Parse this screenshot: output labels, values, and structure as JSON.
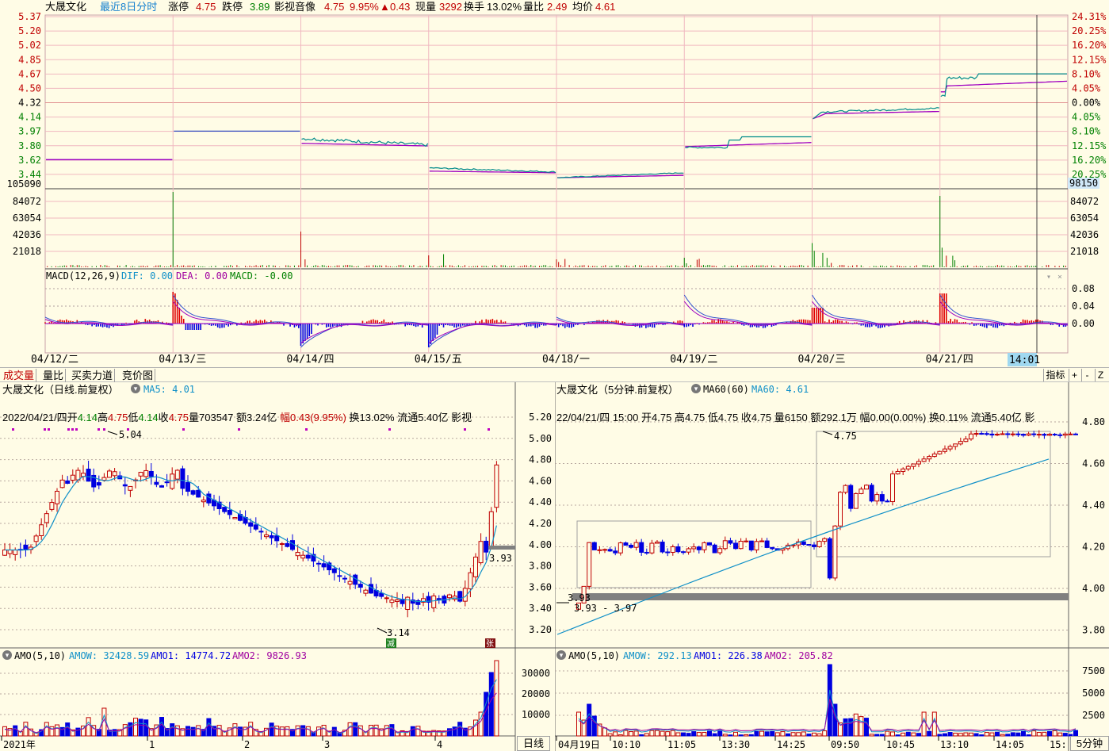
{
  "header": {
    "stock_name": "大晟文化",
    "period": "最近8日分时",
    "limit_up_label": "涨停",
    "limit_up": "4.75",
    "limit_down_label": "跌停",
    "limit_down": "3.89",
    "sector": "影视音像",
    "price": "4.75",
    "change_pct": "9.95%",
    "change": "0.43",
    "volume_label": "现量",
    "volume": "3292",
    "turnover_label": "换手",
    "turnover": "13.02%",
    "vol_ratio_label": "量比",
    "vol_ratio": "2.49",
    "avg_label": "均价",
    "avg": "4.61"
  },
  "intraday": {
    "left_axis": [
      "5.37",
      "5.20",
      "5.02",
      "4.85",
      "4.67",
      "4.50",
      "4.32",
      "4.14",
      "3.97",
      "3.80",
      "3.62",
      "3.44"
    ],
    "right_axis": [
      "24.31%",
      "20.25%",
      "16.20%",
      "12.15%",
      "8.10%",
      "4.05%",
      "0.00%",
      "4.05%",
      "8.10%",
      "12.15%",
      "16.20%",
      "20.25%"
    ],
    "vol_max": "105090",
    "vol_cursor": "98150",
    "vol_axis": [
      "84072",
      "63054",
      "42036",
      "21018"
    ],
    "macd_label": "MACD(12,26,9)",
    "dif_label": "DIF: 0.00",
    "dea_label": "DEA: 0.00",
    "macd_val_label": "MACD: -0.00",
    "macd_axis": [
      "0.08",
      "0.04",
      "0.00"
    ],
    "dates": [
      "04/12/二",
      "04/13/三",
      "04/14/四",
      "04/15/五",
      "04/18/一",
      "04/19/二",
      "04/20/三",
      "04/21/四"
    ],
    "cursor_time": "14:01"
  },
  "tabs": [
    "成交量",
    "量比",
    "买卖力道",
    "竞价图"
  ],
  "tab_buttons": [
    "指标",
    "+",
    "-",
    "Z"
  ],
  "daily": {
    "title": "大晟文化（日线.前复权）",
    "ma_label": "MA5: 4.01",
    "info": "2022/04/21/四",
    "open_label": "开",
    "open": "4.14",
    "high_label": "高",
    "high": "4.75",
    "low_label": "低",
    "low": "4.14",
    "close_label": "收",
    "close": "4.75",
    "vol_label": "量",
    "vol": "703547",
    "amt_label": "额",
    "amt": "3.24亿",
    "amp_label": "幅",
    "amp": "0.43(9.95%)",
    "turn_label": "换",
    "turn": "13.02%",
    "float_label": "流通",
    "float": "5.40亿",
    "more": "影视",
    "high_mark": "5.04",
    "low_mark": "3.14",
    "last_mark": "3.93",
    "axis": [
      "5.20",
      "5.00",
      "4.80",
      "4.60",
      "4.40",
      "4.20",
      "4.00",
      "3.80",
      "3.60",
      "3.40",
      "3.20"
    ],
    "x_labels": [
      "2021年",
      "1",
      "2",
      "3",
      "4"
    ],
    "badge_low": "减",
    "badge_high": "张",
    "amo_label": "AMO(5,10)",
    "amow": "AMOW: 32428.59",
    "amo1": "AMO1: 14774.72",
    "amo2": "AMO2: 9826.93",
    "amo_axis": [
      "30000",
      "20000",
      "10000"
    ],
    "period_button": "日线"
  },
  "min5": {
    "title": "大晟文化（5分钟.前复权）",
    "ma60_label": "MA60(60)",
    "ma60_val": "MA60: 4.61",
    "info": "22/04/21/四  15:00",
    "open_label": "开",
    "open": "4.75",
    "high_label": "高",
    "high": "4.75",
    "low_label": "低",
    "low": "4.75",
    "close_label": "收",
    "close": "4.75",
    "vol_label": "量",
    "vol": "6150",
    "amt_label": "额",
    "amt": "292.1万",
    "amp_label": "幅",
    "amp": "0.00(0.00%)",
    "turn_label": "换",
    "turn": "0.11%",
    "float_label": "流通",
    "float": "5.40亿",
    "more": "影",
    "high_mark": "4.75",
    "low_mark": "3.93",
    "range_mark": "3.93 - 3.97",
    "axis": [
      "4.80",
      "4.60",
      "4.40",
      "4.20",
      "4.00",
      "3.80"
    ],
    "x_labels": [
      "04月19日",
      "10:10",
      "11:05",
      "13:30",
      "14:25",
      "09:50",
      "10:45",
      "13:10",
      "14:05",
      "15:"
    ],
    "amo_label": "AMO(5,10)",
    "amow": "AMOW: 292.13",
    "amo1": "AMO1: 226.38",
    "amo2": "AMO2: 205.82",
    "amo_axis": [
      "7500",
      "5000",
      "2500"
    ],
    "period_button": "5分钟"
  },
  "colors": {
    "up": "#c00000",
    "down": "#0000e0",
    "ma": "#1090c8",
    "avg": "#a000c0",
    "price_line": "#008a8a",
    "grid": "#f0b8c0",
    "bg": "#fffce6"
  }
}
